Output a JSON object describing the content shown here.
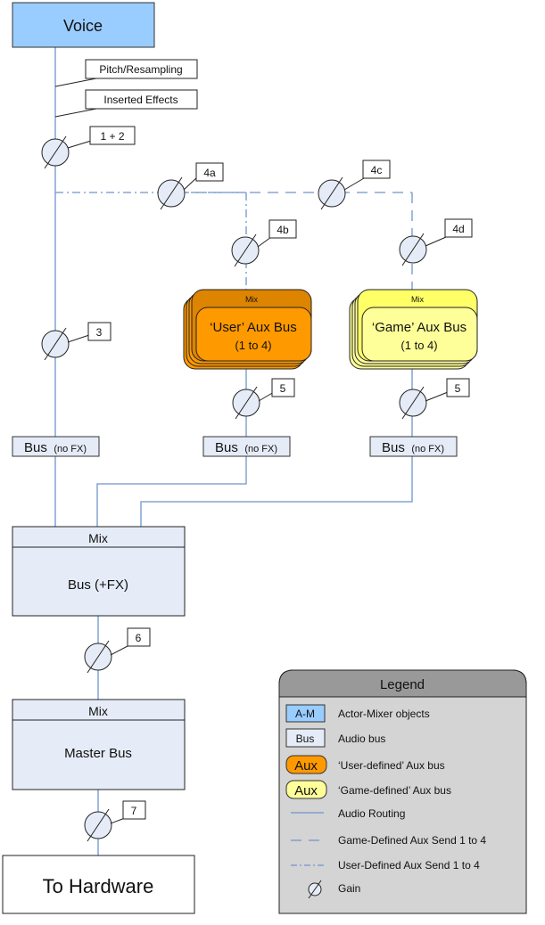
{
  "nodes": {
    "voice": "Voice",
    "pitch": "Pitch/Resampling",
    "inserted": "Inserted Effects",
    "user_aux": {
      "mix": "Mix",
      "line1": "‘User’ Aux Bus",
      "line2": "(1 to 4)"
    },
    "game_aux": {
      "mix": "Mix",
      "line1": "‘Game’ Aux Bus",
      "line2": "(1 to 4)"
    },
    "bus_nofx": {
      "bus": "Bus",
      "suffix": "(no FX)"
    },
    "bus_fx": {
      "mix": "Mix",
      "label": "Bus (+FX)"
    },
    "master": {
      "mix": "Mix",
      "label": "Master Bus"
    },
    "hardware": "To Hardware"
  },
  "gain_labels": {
    "g12": "1 + 2",
    "g3": "3",
    "g4a": "4a",
    "g4b": "4b",
    "g4c": "4c",
    "g4d": "4d",
    "g5user": "5",
    "g5game": "5",
    "g6": "6",
    "g7": "7"
  },
  "legend": {
    "title": "Legend",
    "items": [
      {
        "swatch": "A-M",
        "label": "Actor-Mixer objects"
      },
      {
        "swatch": "Bus",
        "label": "Audio bus"
      },
      {
        "swatch": "Aux",
        "label": "‘User-defined’ Aux bus"
      },
      {
        "swatch": "Aux",
        "label": "‘Game-defined’ Aux bus"
      },
      {
        "swatch": "solid-line",
        "label": "Audio Routing"
      },
      {
        "swatch": "dashed-line",
        "label": "Game-Defined Aux Send 1 to 4"
      },
      {
        "swatch": "dash-dot-line",
        "label": "User-Defined Aux Send 1 to 4"
      },
      {
        "swatch": "gain-icon",
        "label": "Gain"
      }
    ]
  },
  "colors": {
    "actor_mixer": "#99ccff",
    "bus": "#e6ecf7",
    "user_aux": "#ff9900",
    "user_aux_header": "#dd8400",
    "game_aux": "#ffff99",
    "game_aux_header": "#ffff66",
    "routing": "#6f94cc",
    "legend_bg": "#d4d4d4",
    "legend_header": "#999999"
  }
}
